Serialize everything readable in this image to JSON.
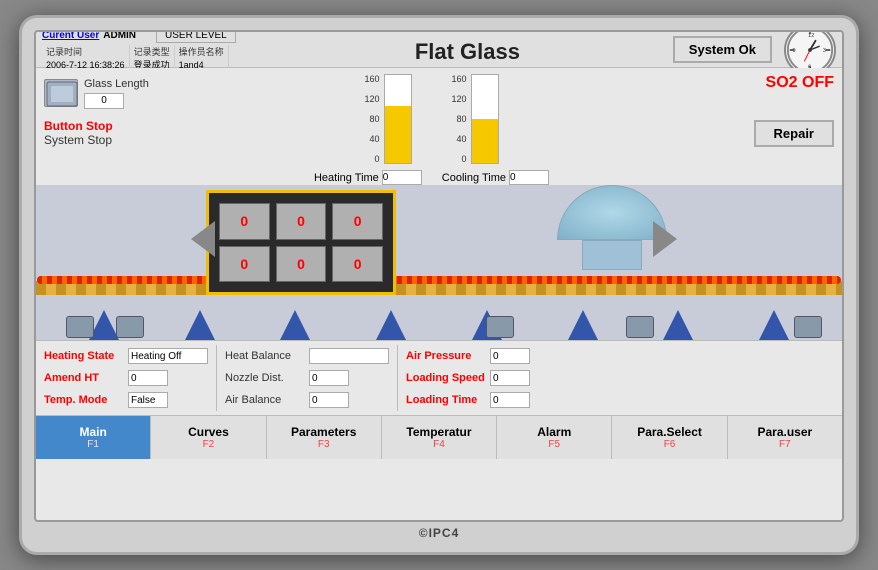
{
  "monitor": {
    "brand": "©IPC4"
  },
  "header": {
    "title": "Flat Glass",
    "system_ok_label": "System Ok",
    "user_level_label": "USER LEVEL",
    "current_user_label": "Curent User",
    "admin_value": "ADMIN",
    "log_headers": [
      "记录时间",
      "记录类型",
      "操作员名称"
    ],
    "log_row1": [
      "2006-7-12  16:38:26",
      "登录成功",
      "1and4"
    ]
  },
  "controls": {
    "glass_length_label": "Glass Length",
    "glass_length_value": "0",
    "button_stop_label": "Button Stop",
    "system_stop_label": "System Stop",
    "heating_time_label": "Heating Time",
    "heating_time_value": "0",
    "cooling_time_label": "Cooling Time",
    "cooling_time_value": "0",
    "so2_label": "SO2 OFF",
    "repair_label": "Repair"
  },
  "gauges": {
    "left_scale": [
      "160",
      "120",
      "80",
      "40",
      "0"
    ],
    "right_scale": [
      "160",
      "120",
      "80",
      "40",
      "0"
    ]
  },
  "oven": {
    "cells": [
      "0",
      "0",
      "0",
      "0",
      "0",
      "0"
    ]
  },
  "status": {
    "heating_state_label": "Heating State",
    "heating_state_value": "Heating Off",
    "amend_ht_label": "Amend HT",
    "amend_ht_value": "0",
    "temp_mode_label": "Temp.  Mode",
    "temp_mode_value": "False",
    "heat_balance_label": "Heat Balance",
    "heat_balance_value": "",
    "nozzle_dist_label": "Nozzle Dist.",
    "nozzle_dist_value": "0",
    "air_balance_label": "Air Balance",
    "air_balance_value": "0",
    "air_pressure_label": "Air Pressure",
    "air_pressure_value": "0",
    "loading_speed_label": "Loading Speed",
    "loading_speed_value": "0",
    "loading_time_label": "Loading Time",
    "loading_time_value": "0"
  },
  "navbar": {
    "items": [
      {
        "label": "Main",
        "key": "F1",
        "active": true
      },
      {
        "label": "Curves",
        "key": "F2",
        "active": false
      },
      {
        "label": "Parameters",
        "key": "F3",
        "active": false
      },
      {
        "label": "Temperatur",
        "key": "F4",
        "active": false
      },
      {
        "label": "Alarm",
        "key": "F5",
        "active": false
      },
      {
        "label": "Para.Select",
        "key": "F6",
        "active": false
      },
      {
        "label": "Para.user",
        "key": "F7",
        "active": false
      }
    ]
  }
}
